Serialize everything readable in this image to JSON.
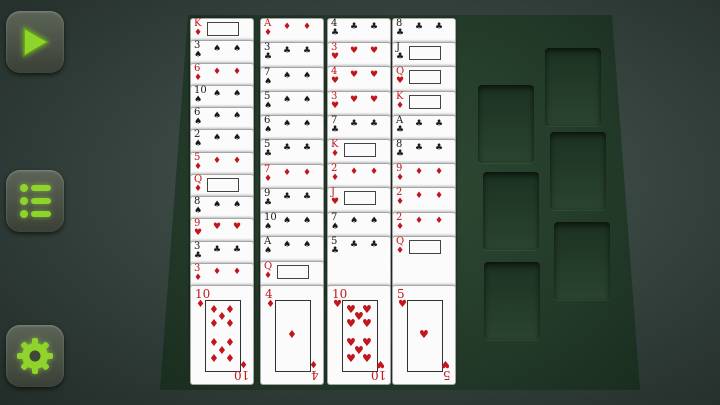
{
  "sidebar": {
    "buttons": [
      {
        "name": "play-button",
        "icon": "play-icon"
      },
      {
        "name": "menu-button",
        "icon": "list-icon"
      },
      {
        "name": "settings-button",
        "icon": "gear-icon"
      }
    ]
  },
  "colors": {
    "accent": "#8fd42a",
    "felt": "#2a4430",
    "red_suit": "#c0161c"
  },
  "tableau": [
    {
      "cards": [
        {
          "rank": "K",
          "suit": "♦",
          "color": "red"
        },
        {
          "rank": "3",
          "suit": "♠",
          "color": "black"
        },
        {
          "rank": "6",
          "suit": "♦",
          "color": "red"
        },
        {
          "rank": "10",
          "suit": "♠",
          "color": "black"
        },
        {
          "rank": "6",
          "suit": "♠",
          "color": "black"
        },
        {
          "rank": "2",
          "suit": "♠",
          "color": "black"
        },
        {
          "rank": "5",
          "suit": "♦",
          "color": "red"
        },
        {
          "rank": "Q",
          "suit": "♦",
          "color": "red"
        },
        {
          "rank": "8",
          "suit": "♠",
          "color": "black"
        },
        {
          "rank": "9",
          "suit": "♥",
          "color": "red"
        },
        {
          "rank": "3",
          "suit": "♣",
          "color": "black"
        },
        {
          "rank": "3",
          "suit": "♦",
          "color": "red"
        },
        {
          "rank": "10",
          "suit": "♦",
          "color": "red"
        }
      ]
    },
    {
      "cards": [
        {
          "rank": "A",
          "suit": "♦",
          "color": "red"
        },
        {
          "rank": "3",
          "suit": "♣",
          "color": "black"
        },
        {
          "rank": "7",
          "suit": "♠",
          "color": "black"
        },
        {
          "rank": "5",
          "suit": "♠",
          "color": "black"
        },
        {
          "rank": "6",
          "suit": "♠",
          "color": "black"
        },
        {
          "rank": "5",
          "suit": "♣",
          "color": "black"
        },
        {
          "rank": "7",
          "suit": "♦",
          "color": "red"
        },
        {
          "rank": "9",
          "suit": "♣",
          "color": "black"
        },
        {
          "rank": "10",
          "suit": "♠",
          "color": "black"
        },
        {
          "rank": "A",
          "suit": "♠",
          "color": "black"
        },
        {
          "rank": "Q",
          "suit": "♦",
          "color": "red"
        },
        {
          "rank": "4",
          "suit": "♦",
          "color": "red"
        }
      ]
    },
    {
      "cards": [
        {
          "rank": "4",
          "suit": "♣",
          "color": "black"
        },
        {
          "rank": "3",
          "suit": "♥",
          "color": "red"
        },
        {
          "rank": "4",
          "suit": "♥",
          "color": "red"
        },
        {
          "rank": "3",
          "suit": "♥",
          "color": "red"
        },
        {
          "rank": "7",
          "suit": "♣",
          "color": "black"
        },
        {
          "rank": "K",
          "suit": "♦",
          "color": "red"
        },
        {
          "rank": "2",
          "suit": "♦",
          "color": "red"
        },
        {
          "rank": "J",
          "suit": "♥",
          "color": "red"
        },
        {
          "rank": "7",
          "suit": "♠",
          "color": "black"
        },
        {
          "rank": "5",
          "suit": "♣",
          "color": "black"
        },
        {
          "rank": "10",
          "suit": "♥",
          "color": "red"
        }
      ]
    },
    {
      "cards": [
        {
          "rank": "8",
          "suit": "♣",
          "color": "black"
        },
        {
          "rank": "J",
          "suit": "♣",
          "color": "black"
        },
        {
          "rank": "Q",
          "suit": "♥",
          "color": "red"
        },
        {
          "rank": "K",
          "suit": "♦",
          "color": "red"
        },
        {
          "rank": "A",
          "suit": "♣",
          "color": "black"
        },
        {
          "rank": "8",
          "suit": "♣",
          "color": "black"
        },
        {
          "rank": "9",
          "suit": "♦",
          "color": "red"
        },
        {
          "rank": "2",
          "suit": "♦",
          "color": "red"
        },
        {
          "rank": "2",
          "suit": "♦",
          "color": "red"
        },
        {
          "rank": "Q",
          "suit": "♦",
          "color": "red"
        },
        {
          "rank": "5",
          "suit": "♥",
          "color": "red"
        }
      ]
    }
  ],
  "empty_slots_count": 6
}
